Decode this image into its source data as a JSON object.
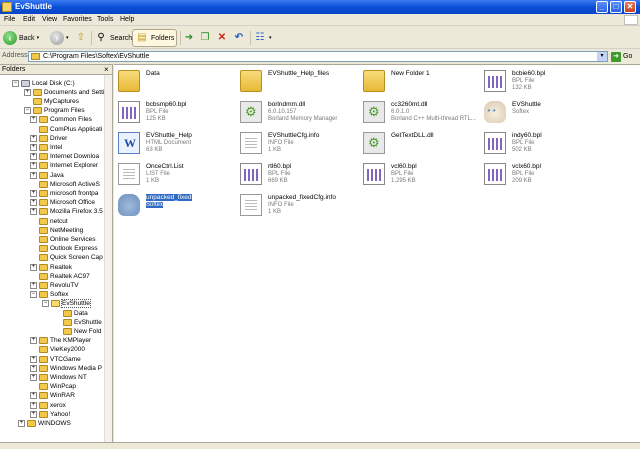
{
  "window": {
    "title": "EvShuttle"
  },
  "title_buttons": {
    "minimize": "_",
    "maximize": "□",
    "close": "✕"
  },
  "menu": [
    "File",
    "Edit",
    "View",
    "Favorites",
    "Tools",
    "Help"
  ],
  "toolbar": {
    "back": "Back",
    "search": "Search",
    "folders": "Folders"
  },
  "address": {
    "label": "Address",
    "path": "C:\\Program Files\\Softex\\EvShuttle",
    "go": "Go"
  },
  "tree": {
    "header": "Folders",
    "close": "×",
    "items": [
      {
        "label": "Local Disk (C:)",
        "expander": "-"
      },
      {
        "label": "Documents and Settin",
        "expander": "+"
      },
      {
        "label": "MyCaptures",
        "expander": ""
      },
      {
        "label": "Program Files",
        "expander": "-"
      },
      {
        "label": "Common Files",
        "expander": "+"
      },
      {
        "label": "ComPlus Applicati",
        "expander": ""
      },
      {
        "label": "Driver",
        "expander": "+"
      },
      {
        "label": "Intel",
        "expander": "+"
      },
      {
        "label": "Internet Downloa",
        "expander": "+"
      },
      {
        "label": "Internet Explorer",
        "expander": "+"
      },
      {
        "label": "Java",
        "expander": "+"
      },
      {
        "label": "Microsoft ActiveS",
        "expander": ""
      },
      {
        "label": "microsoft frontpa",
        "expander": "+"
      },
      {
        "label": "Microsoft Office",
        "expander": "+"
      },
      {
        "label": "Mozilla Firefox 3.5",
        "expander": "+"
      },
      {
        "label": "netcut",
        "expander": ""
      },
      {
        "label": "NetMeeting",
        "expander": ""
      },
      {
        "label": "Online Services",
        "expander": ""
      },
      {
        "label": "Outlook Express",
        "expander": ""
      },
      {
        "label": "Quick Screen Cap",
        "expander": ""
      },
      {
        "label": "Realtek",
        "expander": "+"
      },
      {
        "label": "Realtek AC97",
        "expander": ""
      },
      {
        "label": "RevoluTV",
        "expander": "+"
      },
      {
        "label": "Softex",
        "expander": "-"
      },
      {
        "label": "EvShuttle",
        "expander": "-"
      },
      {
        "label": "Data",
        "expander": ""
      },
      {
        "label": "EvShuttle",
        "expander": ""
      },
      {
        "label": "New Fold",
        "expander": ""
      },
      {
        "label": "The KMPlayer",
        "expander": "+"
      },
      {
        "label": "VieKey2000",
        "expander": ""
      },
      {
        "label": "VTCGame",
        "expander": "+"
      },
      {
        "label": "Windows Media P",
        "expander": "+"
      },
      {
        "label": "Windows NT",
        "expander": "+"
      },
      {
        "label": "WinPcap",
        "expander": ""
      },
      {
        "label": "WinRAR",
        "expander": "+"
      },
      {
        "label": "xerox",
        "expander": "+"
      },
      {
        "label": "Yahoo!",
        "expander": "+"
      },
      {
        "label": "WINDOWS",
        "expander": "+"
      }
    ]
  },
  "files": [
    {
      "name": "Data",
      "l2": "",
      "l3": "",
      "icon": "folder"
    },
    {
      "name": "EVShuttle_Help_files",
      "l2": "",
      "l3": "",
      "icon": "folder"
    },
    {
      "name": "New Folder 1",
      "l2": "",
      "l3": "",
      "icon": "folder"
    },
    {
      "name": "bcbie60.bpl",
      "l2": "BPL File",
      "l3": "132 KB",
      "icon": "bpl"
    },
    {
      "name": "bcbsmp60.bpl",
      "l2": "BPL File",
      "l3": "125 KB",
      "icon": "bpl"
    },
    {
      "name": "borlndmm.dll",
      "l2": "6.0.10.157",
      "l3": "Borland Memory Manager",
      "icon": "dll"
    },
    {
      "name": "cc3260mt.dll",
      "l2": "6.0.1.0",
      "l3": "Borland C++ Multi-thread RTL...",
      "icon": "dll"
    },
    {
      "name": "EVShuttle",
      "l2": "Softex",
      "l3": "",
      "icon": "cat"
    },
    {
      "name": "EVShuttle_Help",
      "l2": "HTML Document",
      "l3": "63 KB",
      "icon": "html"
    },
    {
      "name": "EVShuttleCfg.info",
      "l2": "INFO File",
      "l3": "1 KB",
      "icon": "info"
    },
    {
      "name": "GetTextDLL.dll",
      "l2": "",
      "l3": "",
      "icon": "dll"
    },
    {
      "name": "indy60.bpl",
      "l2": "BPL File",
      "l3": "502 KB",
      "icon": "bpl"
    },
    {
      "name": "OnceCtrl.List",
      "l2": "LIST File",
      "l3": "1 KB",
      "icon": "info"
    },
    {
      "name": "rtl60.bpl",
      "l2": "BPL File",
      "l3": "669 KB",
      "icon": "bpl"
    },
    {
      "name": "vcl60.bpl",
      "l2": "BPL File",
      "l3": "1,295 KB",
      "icon": "bpl"
    },
    {
      "name": "vclx60.bpl",
      "l2": "BPL File",
      "l3": "209 KB",
      "icon": "bpl"
    },
    {
      "name": "unpacked_fixed",
      "l2": "Softex",
      "l3": "",
      "icon": "cat-blue",
      "selected": true
    },
    {
      "name": "unpacked_fixedCfg.info",
      "l2": "INFO File",
      "l3": "1 KB",
      "icon": "info"
    }
  ]
}
